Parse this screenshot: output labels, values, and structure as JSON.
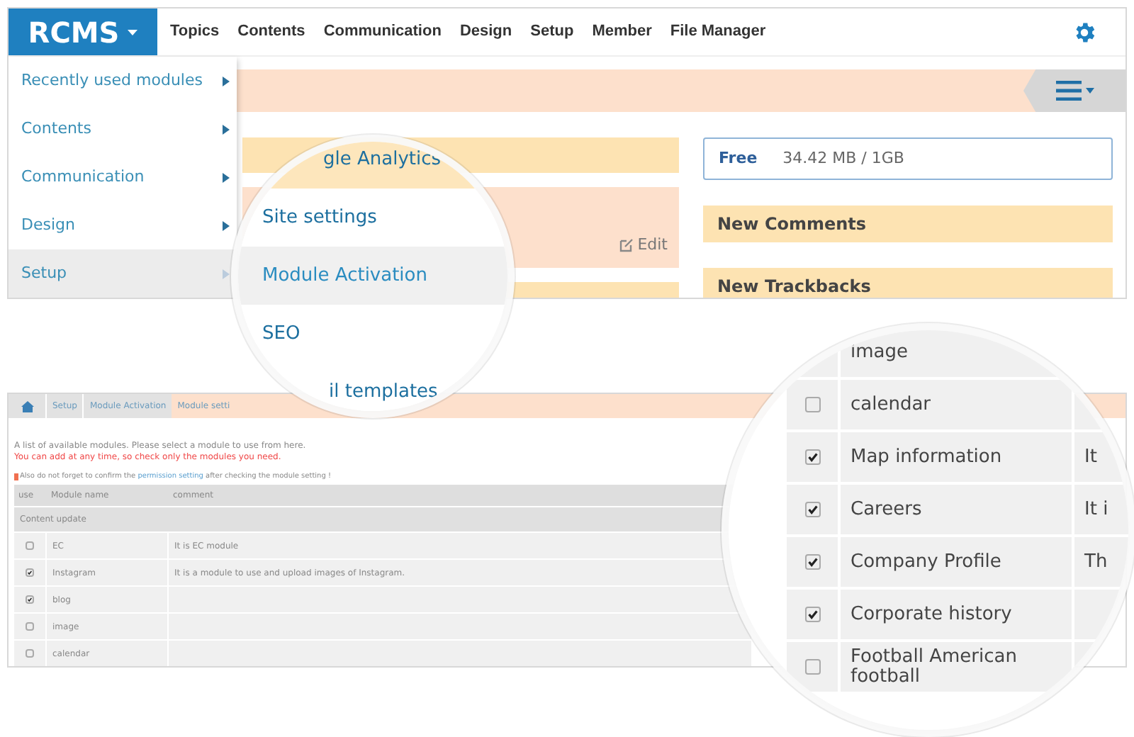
{
  "top_screenshot": {
    "logo": "RCMS",
    "nav": [
      "Topics",
      "Contents",
      "Communication",
      "Design",
      "Setup",
      "Member",
      "File Manager"
    ],
    "menu": [
      {
        "label": "Recently used modules",
        "selected": false
      },
      {
        "label": "Contents",
        "selected": false
      },
      {
        "label": "Communication",
        "selected": false
      },
      {
        "label": "Design",
        "selected": false
      },
      {
        "label": "Setup",
        "selected": true
      }
    ],
    "edit_link": "Edit",
    "storage_label": "Free",
    "storage_value": "34.42 MB / 1GB",
    "widgets": [
      "New Comments",
      "New Trackbacks"
    ]
  },
  "magnifier_menu": [
    {
      "label": "gle Analytics",
      "selected": false
    },
    {
      "label": "Site settings",
      "selected": false
    },
    {
      "label": "Module Activation",
      "selected": true
    },
    {
      "label": "SEO",
      "selected": false
    },
    {
      "label": "il templates",
      "selected": false
    }
  ],
  "bottom_screenshot": {
    "breadcrumb": [
      {
        "label": "Setup",
        "selected": false
      },
      {
        "label": "Module Activation",
        "selected": false
      },
      {
        "label": "Module setti",
        "selected": true
      }
    ],
    "intro": "A list of available modules. Please select a module to use from here.",
    "notice": "You can add at any time, so check only the modules you need.",
    "reminder_before": "Also do not forget to confirm the",
    "reminder_link": "permission setting",
    "reminder_after": "after checking the module setting !",
    "columns": [
      "use",
      "Module name",
      "comment"
    ],
    "group": "Content update",
    "rows": [
      {
        "checked": false,
        "name": "EC",
        "comment": "It is EC module"
      },
      {
        "checked": true,
        "name": "Instagram",
        "comment": "It is a module to use and upload images of Instagram."
      },
      {
        "checked": true,
        "name": "blog"
      },
      {
        "checked": false,
        "name": "image"
      },
      {
        "checked": false,
        "name": "calendar"
      }
    ]
  },
  "magnifier_table": [
    {
      "name": "image"
    },
    {
      "checked": false,
      "name": "calendar"
    },
    {
      "checked": true,
      "name": "Map information",
      "comment": "It"
    },
    {
      "checked": true,
      "name": "Careers",
      "comment": "It i"
    },
    {
      "checked": true,
      "name": "Company Profile",
      "comment": "Th"
    },
    {
      "checked": true,
      "name": "Corporate history"
    },
    {
      "checked": false,
      "name": "Football American football"
    }
  ]
}
